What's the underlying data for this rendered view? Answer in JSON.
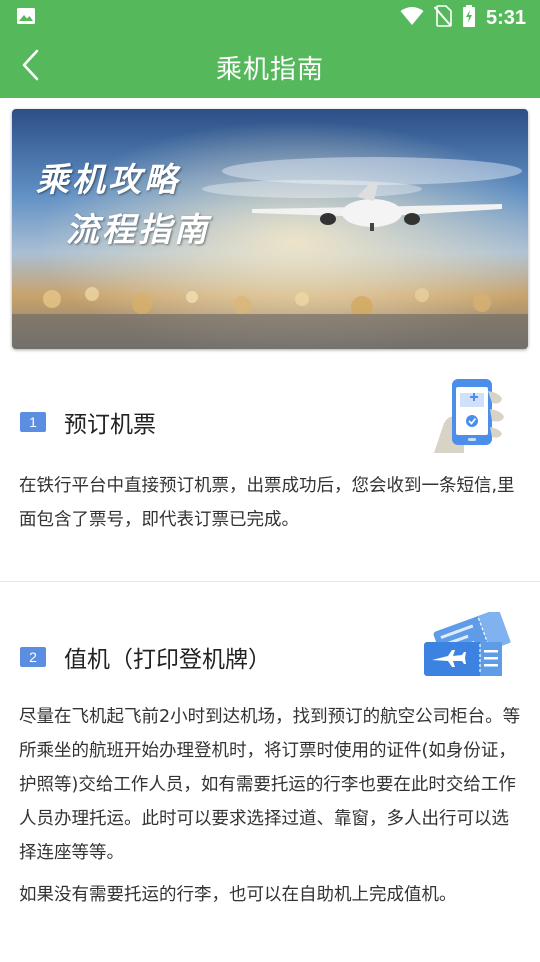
{
  "status_bar": {
    "time": "5:31",
    "icons": [
      "image-icon",
      "wifi-icon",
      "no-sim-icon",
      "battery-charging-icon"
    ]
  },
  "app_bar": {
    "title": "乘机指南",
    "back_icon": "chevron-left-icon"
  },
  "banner": {
    "line1": "乘机攻略",
    "line2": "流程指南"
  },
  "steps": [
    {
      "number": "1",
      "title": "预订机票",
      "icon": "phone-booking-icon",
      "paragraphs": [
        "在铁行平台中直接预订机票，出票成功后，您会收到一条短信,里面包含了票号，即代表订票已完成。"
      ]
    },
    {
      "number": "2",
      "title": "值机（打印登机牌）",
      "icon": "boarding-pass-icon",
      "paragraphs": [
        "尽量在飞机起飞前2小时到达机场，找到预订的航空公司柜台。等所乘坐的航班开始办理登机时，将订票时使用的证件(如身份证，护照等)交给工作人员，如有需要托运的行李也要在此时交给工作人员办理托运。此时可以要求选择过道、靠窗，多人出行可以选择连座等等。",
        "如果没有需要托运的行李，也可以在自助机上完成值机。"
      ]
    }
  ],
  "colors": {
    "primary": "#55b95c",
    "step_badge": "#5b8de0",
    "text": "#333333"
  }
}
